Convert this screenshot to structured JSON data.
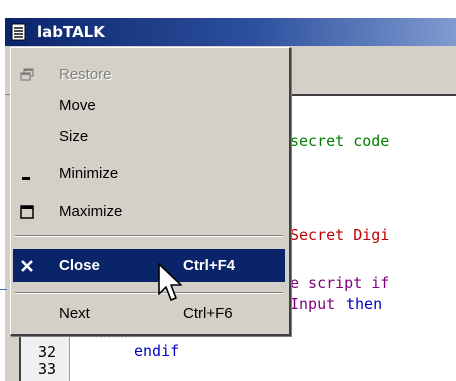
{
  "window": {
    "title": "labTALK",
    "app_icon": "document-icon"
  },
  "editor": {
    "lines": [
      {
        "id": "l1",
        "text": "secret code",
        "color": "#008000"
      },
      {
        "id": "l2",
        "text": "Secret Digi",
        "color": "#c00000"
      },
      {
        "id": "l3",
        "text": "e script if",
        "color": "#800080"
      },
      {
        "id": "l4a",
        "text": "Input",
        "color": "#800080"
      },
      {
        "id": "l4b",
        "text": "then",
        "color": "#0000c0"
      },
      {
        "id": "l5",
        "text": "endif",
        "color": "#0000c0"
      }
    ],
    "line_numbers": [
      "32",
      "33"
    ]
  },
  "system_menu": {
    "items": [
      {
        "label": "Restore",
        "icon": "restore-icon",
        "disabled": true,
        "shortcut": ""
      },
      {
        "label": "Move",
        "icon": "",
        "disabled": false,
        "shortcut": ""
      },
      {
        "label": "Size",
        "icon": "",
        "disabled": false,
        "shortcut": ""
      },
      {
        "label": "Minimize",
        "icon": "minimize-icon",
        "disabled": false,
        "shortcut": ""
      },
      {
        "label": "Maximize",
        "icon": "maximize-icon",
        "disabled": false,
        "shortcut": ""
      },
      {
        "label": "Close",
        "icon": "close-icon",
        "disabled": false,
        "shortcut": "Ctrl+F4",
        "highlighted": true
      },
      {
        "label": "Next",
        "icon": "",
        "disabled": false,
        "shortcut": "Ctrl+F6"
      }
    ]
  },
  "colors": {
    "titlebar": "#0a246a",
    "menu_bg": "#d4d0c8",
    "highlight": "#0a246a"
  }
}
